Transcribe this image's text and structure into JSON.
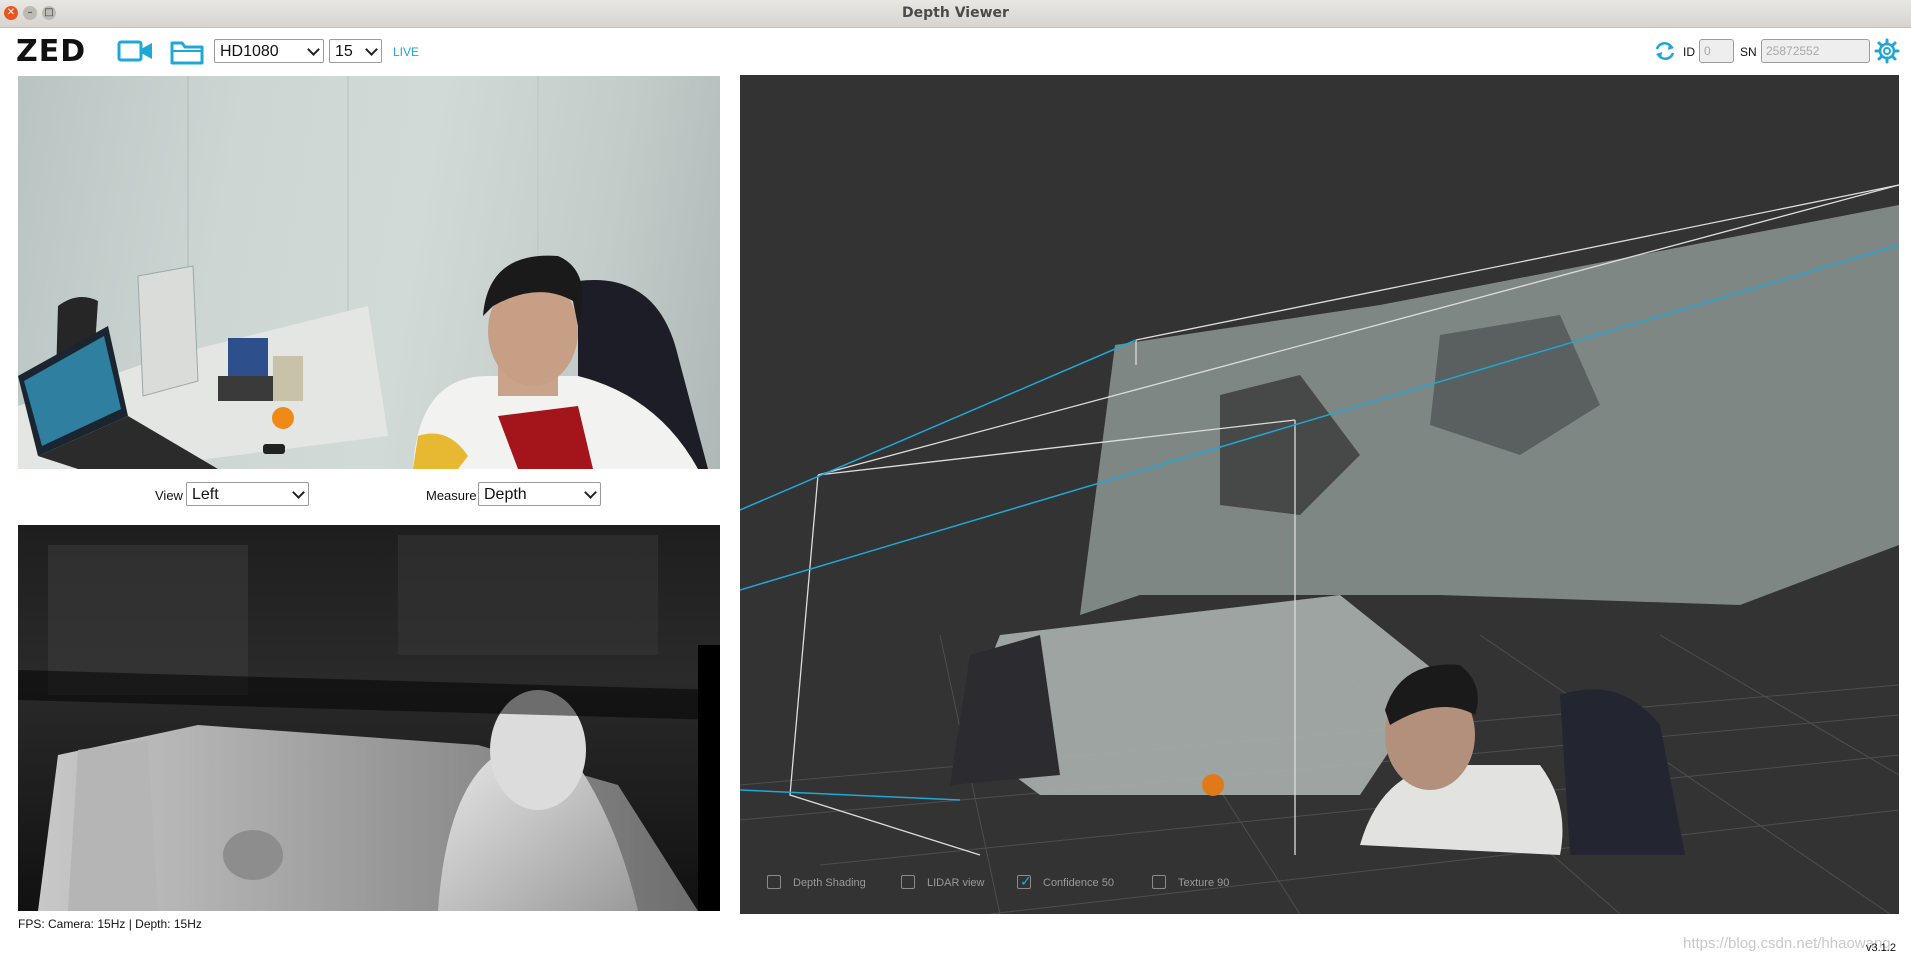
{
  "window": {
    "title": "Depth Viewer",
    "close_glyph": "✕",
    "min_glyph": "–",
    "max_glyph": "□"
  },
  "toolbar": {
    "logo": "ZED",
    "camera_icon": "video-camera-icon",
    "folder_icon": "folder-icon",
    "resolution": "HD1080",
    "fps": "15",
    "live_label": "LIVE",
    "refresh_icon": "refresh-icon",
    "id_label": "ID",
    "id_placeholder": "0",
    "sn_label": "SN",
    "sn_value": "25872552",
    "settings_icon": "gear-icon",
    "accent_color": "#1fa7d8"
  },
  "view_controls": {
    "view_label": "View",
    "view_value": "Left",
    "measure_label": "Measure",
    "measure_value": "Depth"
  },
  "status": {
    "fps_text": "FPS: Camera: 15Hz | Depth: 15Hz"
  },
  "point_cloud": {
    "options": [
      {
        "label": "Depth Shading",
        "checked": false
      },
      {
        "label": "LIDAR view",
        "checked": false
      },
      {
        "label": "Confidence 50",
        "checked": true
      },
      {
        "label": "Texture 90",
        "checked": false
      }
    ],
    "check_glyph": "✓"
  },
  "footer": {
    "version": "v3.1.2",
    "watermark": "https://blog.csdn.net/hhaowang"
  }
}
